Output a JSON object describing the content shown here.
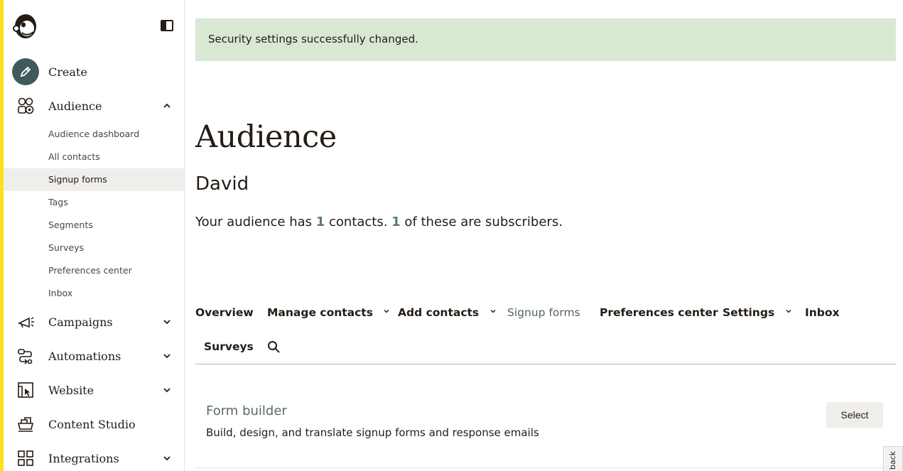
{
  "banner": {
    "message": "Security settings successfully changed."
  },
  "sidebar": {
    "create_label": "Create",
    "audience_label": "Audience",
    "sub_items": [
      "Audience dashboard",
      "All contacts",
      "Signup forms",
      "Tags",
      "Segments",
      "Surveys",
      "Preferences center",
      "Inbox"
    ],
    "active_sub_item": "Signup forms",
    "items": [
      {
        "label": "Campaigns",
        "icon": "megaphone-icon",
        "expandable": true
      },
      {
        "label": "Automations",
        "icon": "automation-icon",
        "expandable": true
      },
      {
        "label": "Website",
        "icon": "website-icon",
        "expandable": true
      },
      {
        "label": "Content Studio",
        "icon": "content-studio-icon",
        "expandable": false
      },
      {
        "label": "Integrations",
        "icon": "integrations-icon",
        "expandable": true
      }
    ]
  },
  "main": {
    "title": "Audience",
    "audience_name": "David",
    "summary": {
      "prefix": "Your audience has ",
      "contacts": "1",
      "middle": " contacts. ",
      "subscribers": "1",
      "suffix": " of these are subscribers."
    },
    "tabs": [
      {
        "label": "Overview",
        "dropdown": false
      },
      {
        "label": "Manage contacts",
        "dropdown": true
      },
      {
        "label": "Add contacts",
        "dropdown": true
      },
      {
        "label": "Signup forms",
        "dropdown": false,
        "current": true
      },
      {
        "label": "Preferences center",
        "dropdown": false
      },
      {
        "label": "Settings",
        "dropdown": true
      },
      {
        "label": "Inbox",
        "dropdown": false
      },
      {
        "label": "Surveys",
        "dropdown": false
      }
    ],
    "form_builder": {
      "title": "Form builder",
      "description": "Build, design, and translate signup forms and response emails",
      "button": "Select"
    },
    "feedback_label": "back"
  },
  "colors": {
    "accent_yellow": "#ffe01b",
    "banner_green": "#d9e8d2",
    "create_circle": "#3e5b5a",
    "active_row": "#efeeea"
  }
}
